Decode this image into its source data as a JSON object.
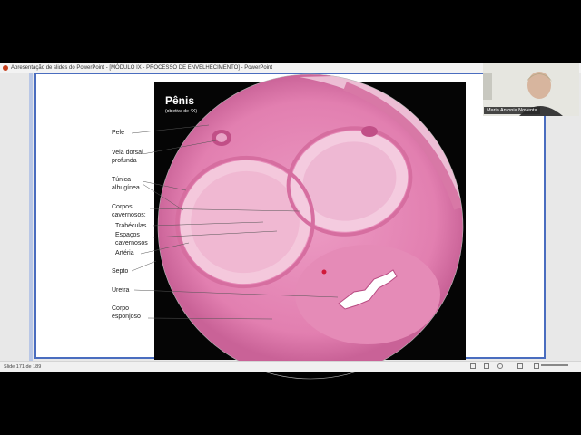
{
  "window": {
    "title": "Apresentação de slides do PowerPoint - [MÓDULO IX - PROCESSO DE ENVELHECIMENTO] - PowerPoint"
  },
  "slide": {
    "title": "Pênis",
    "subtitle": "(objetiva de 4X)",
    "labels": {
      "pele": "Pele",
      "veia": "Veia dorsal\nprofunda",
      "tunica": "Túnica\nalbugínea",
      "corpos": "Corpos\ncavernosos:",
      "trabeculas": "Trabéculas",
      "espacos": "Espaços\ncavernosos",
      "arteria": "Artéria",
      "septo": "Septo",
      "uretra": "Uretra",
      "esponjoso": "Corpo\nesponjoso"
    }
  },
  "status_bar": {
    "slide_counter": "Slide 171 de 189"
  },
  "webcam": {
    "name": "Maria Antonia Noventa"
  },
  "colors": {
    "slide_border": "#4a6dbf",
    "tissue_pink": "#e889b8",
    "tissue_light": "#f3c9dc"
  },
  "icons": [
    "powerpoint-icon",
    "normal-view-icon",
    "slide-sorter-icon",
    "reading-view-icon",
    "slideshow-icon",
    "zoom-slider"
  ]
}
